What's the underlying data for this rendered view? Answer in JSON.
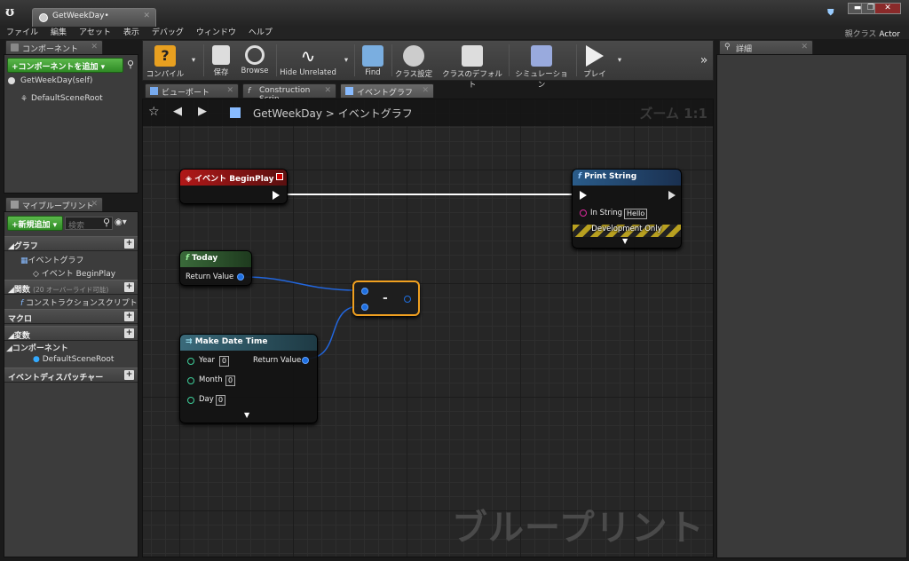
{
  "window": {
    "tab_title": "GetWeekDay•",
    "parent_label": "親クラス",
    "parent_value": "Actor"
  },
  "menu": [
    "ファイル",
    "編集",
    "アセット",
    "表示",
    "デバッグ",
    "ウィンドウ",
    "ヘルプ"
  ],
  "components": {
    "tab": "コンポーネント",
    "add_button": "+コンポーネントを追加 ▾",
    "self": "GetWeekDay(self)",
    "root": "DefaultSceneRoot"
  },
  "my_blueprint": {
    "tab": "マイブループリント",
    "new_button": "+新規追加 ▾",
    "search_placeholder": "検索",
    "sections": {
      "graph": "グラフ",
      "event_graph": "イベントグラフ",
      "begin_play": "イベント BeginPlay",
      "functions": "関数",
      "functions_note": "(20 オーバーライド可能)",
      "construction": "コンストラクションスクリプト",
      "macros": "マクロ",
      "variables": "変数",
      "components": "コンポーネント",
      "default_root": "DefaultSceneRoot",
      "dispatchers": "イベントディスパッチャー"
    }
  },
  "toolbar": {
    "compile": "コンパイル",
    "save": "保存",
    "browse": "Browse",
    "hide_unrelated": "Hide Unrelated",
    "find": "Find",
    "class_settings": "クラス設定",
    "class_defaults": "クラスのデフォルト",
    "simulation": "シミュレーション",
    "play": "プレイ"
  },
  "editor_tabs": [
    "ビューポート",
    "Construction Scrip",
    "イベントグラフ"
  ],
  "graph": {
    "breadcrumb_root": "GetWeekDay",
    "breadcrumb_sep": ">",
    "breadcrumb_current": "イベントグラフ",
    "zoom": "ズーム 1:1",
    "watermark": "ブループリント"
  },
  "nodes": {
    "begin_play": {
      "title": "イベント BeginPlay"
    },
    "print_string": {
      "title": "Print String",
      "in_string": "In String",
      "in_value": "Hello",
      "dev_only": "Development Only"
    },
    "today": {
      "title": "Today",
      "return": "Return Value"
    },
    "subtract": {
      "op": "-"
    },
    "make_date": {
      "title": "Make Date Time",
      "year": "Year",
      "month": "Month",
      "day": "Day",
      "year_val": "0",
      "month_val": "0",
      "day_val": "0",
      "return": "Return Value"
    }
  },
  "details": {
    "tab": "詳細"
  }
}
